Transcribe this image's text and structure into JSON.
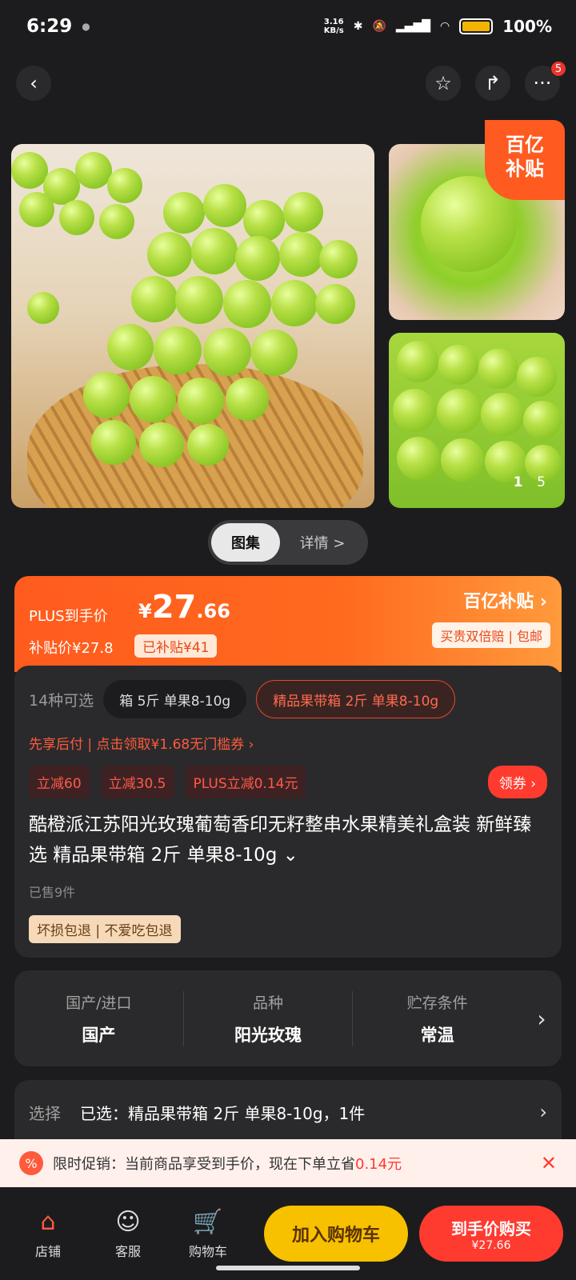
{
  "status": {
    "time": "6:29",
    "net_speed": "3.16\nKB/s",
    "battery": "100%"
  },
  "topnav": {
    "badge": "5"
  },
  "gallery": {
    "subsidy_tag": "百亿补贴",
    "page_current": "1",
    "page_total": "5"
  },
  "tabs": {
    "active": "图集",
    "inactive": "详情 >"
  },
  "price": {
    "plus_label": "PLUS到手价",
    "currency": "¥",
    "plus_int": "27",
    "plus_dec": ".66",
    "subsidy_price": "补贴价¥27.8",
    "subsidy_tag": "已补贴¥41",
    "brand": "百亿补贴 ›",
    "brand_sub": "买贵双倍赔 | 包邮"
  },
  "product": {
    "variant_count": "14种可选",
    "variant_1": "箱 5斤 单果8-10g",
    "variant_2": "精品果带箱 2斤 单果8-10g",
    "coupon_line": "先享后付 | 点击领取¥1.68无门槛券 ›",
    "promos": [
      "立减60",
      "立减30.5",
      "PLUS立减0.14元"
    ],
    "coupon_btn": "领券 ›",
    "title": "酷橙派江苏阳光玫瑰葡萄香印无籽整串水果精美礼盒装 新鲜臻选 精品果带箱 2斤 单果8-10g ⌄",
    "sold": "已售9件",
    "guarantee": "坏损包退 | 不爱吃包退"
  },
  "attrs": [
    {
      "k": "国产/进口",
      "v": "国产"
    },
    {
      "k": "品种",
      "v": "阳光玫瑰"
    },
    {
      "k": "贮存条件",
      "v": "常温"
    }
  ],
  "select": {
    "label": "选择",
    "value": "已选：精品果带箱 2斤 单果8-10g，1件"
  },
  "banner": {
    "text": "限时促销：当前商品享受到手价，现在下单立省",
    "amount": "0.14元"
  },
  "bottom": {
    "store": "店铺",
    "service": "客服",
    "cart": "购物车",
    "add_cart": "加入购物车",
    "buy": "到手价购买",
    "buy_sub": "¥27.66"
  }
}
